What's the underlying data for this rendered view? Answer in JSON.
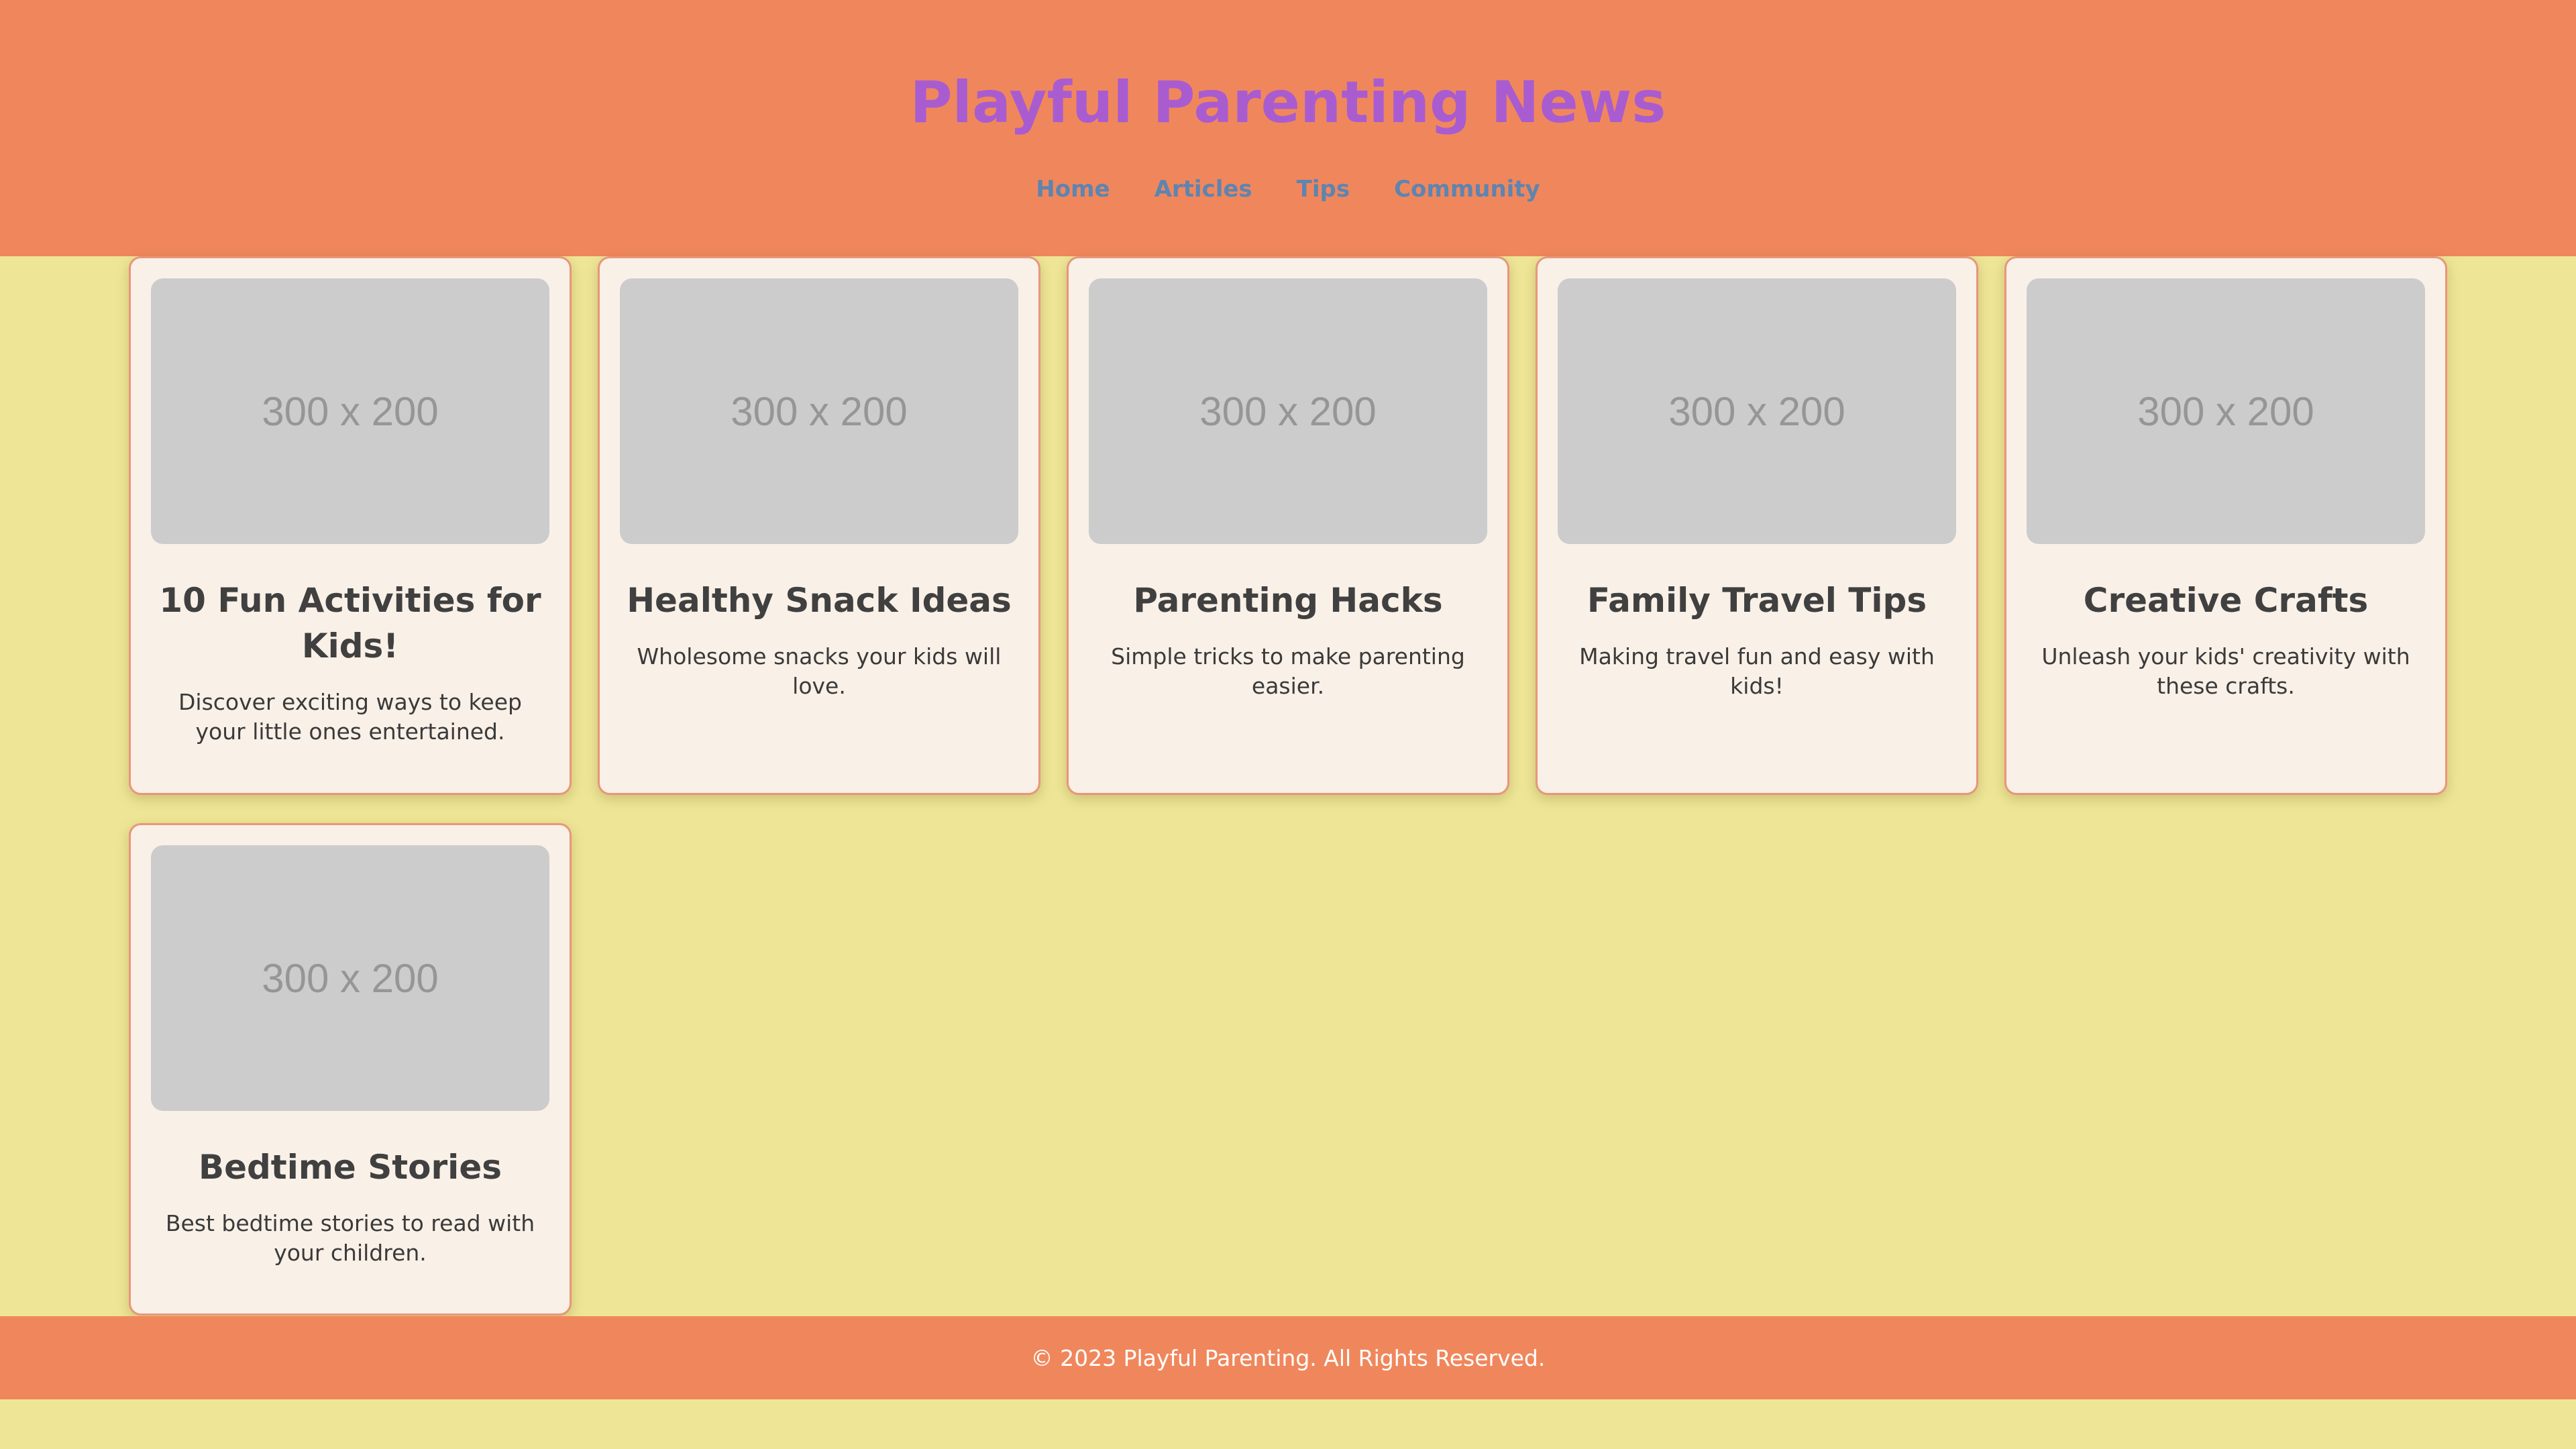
{
  "header": {
    "title": "Playful Parenting News",
    "nav": [
      {
        "label": "Home"
      },
      {
        "label": "Articles"
      },
      {
        "label": "Tips"
      },
      {
        "label": "Community"
      }
    ]
  },
  "articles": [
    {
      "image_label": "300 x 200",
      "title": "10 Fun Activities for Kids!",
      "description": "Discover exciting ways to keep your little ones entertained."
    },
    {
      "image_label": "300 x 200",
      "title": "Healthy Snack Ideas",
      "description": "Wholesome snacks your kids will love."
    },
    {
      "image_label": "300 x 200",
      "title": "Parenting Hacks",
      "description": "Simple tricks to make parenting easier."
    },
    {
      "image_label": "300 x 200",
      "title": "Family Travel Tips",
      "description": "Making travel fun and easy with kids!"
    },
    {
      "image_label": "300 x 200",
      "title": "Creative Crafts",
      "description": "Unleash your kids' creativity with these crafts."
    },
    {
      "image_label": "300 x 200",
      "title": "Bedtime Stories",
      "description": "Best bedtime stories to read with your children."
    }
  ],
  "footer": {
    "text": "© 2023 Playful Parenting. All Rights Reserved."
  },
  "colors": {
    "header_bg": "#F0875C",
    "page_bg": "#EEE696",
    "title": "#A95CD0",
    "nav_link": "#5E84B0",
    "card_bg": "#F9F0E7",
    "card_border": "#E8967A",
    "placeholder_bg": "#CCCCCC"
  }
}
